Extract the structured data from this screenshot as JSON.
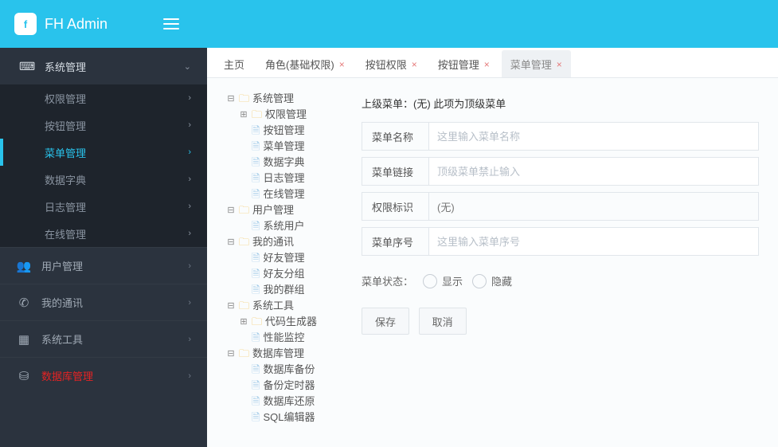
{
  "brand": {
    "logo": "f",
    "title": "FH Admin"
  },
  "sidebar": {
    "active_group": "系统管理",
    "groups": [
      {
        "icon": "⌨",
        "label": "系统管理",
        "sub": [
          {
            "label": "权限管理"
          },
          {
            "label": "按钮管理"
          },
          {
            "label": "菜单管理",
            "active": true
          },
          {
            "label": "数据字典"
          },
          {
            "label": "日志管理"
          },
          {
            "label": "在线管理"
          }
        ]
      },
      {
        "icon": "👥",
        "label": "用户管理"
      },
      {
        "icon": "✆",
        "label": "我的通讯"
      },
      {
        "icon": "▦",
        "label": "系统工具"
      },
      {
        "icon": "⛁",
        "label": "数据库管理",
        "red": true
      }
    ]
  },
  "tabs": [
    {
      "label": "主页"
    },
    {
      "label": "角色(基础权限)",
      "close": true
    },
    {
      "label": "按钮权限",
      "close": true
    },
    {
      "label": "按钮管理",
      "close": true
    },
    {
      "label": "菜单管理",
      "close": true,
      "active": true
    }
  ],
  "tree": [
    {
      "label": "系统管理",
      "type": "folder",
      "open": true,
      "children": [
        {
          "label": "权限管理",
          "type": "folder",
          "closed": true
        },
        {
          "label": "按钮管理",
          "type": "file"
        },
        {
          "label": "菜单管理",
          "type": "file"
        },
        {
          "label": "数据字典",
          "type": "file"
        },
        {
          "label": "日志管理",
          "type": "file"
        },
        {
          "label": "在线管理",
          "type": "file"
        }
      ]
    },
    {
      "label": "用户管理",
      "type": "folder",
      "open": true,
      "children": [
        {
          "label": "系统用户",
          "type": "file"
        }
      ]
    },
    {
      "label": "我的通讯",
      "type": "folder",
      "open": true,
      "children": [
        {
          "label": "好友管理",
          "type": "file"
        },
        {
          "label": "好友分组",
          "type": "file"
        },
        {
          "label": "我的群组",
          "type": "file"
        }
      ]
    },
    {
      "label": "系统工具",
      "type": "folder",
      "open": true,
      "children": [
        {
          "label": "代码生成器",
          "type": "folder",
          "closed": true
        },
        {
          "label": "性能监控",
          "type": "file"
        }
      ]
    },
    {
      "label": "数据库管理",
      "type": "folder",
      "open": true,
      "children": [
        {
          "label": "数据库备份",
          "type": "file"
        },
        {
          "label": "备份定时器",
          "type": "file"
        },
        {
          "label": "数据库还原",
          "type": "file"
        },
        {
          "label": "SQL编辑器",
          "type": "file"
        }
      ]
    }
  ],
  "form": {
    "parent_label": "上级菜单：",
    "parent_value": "(无) 此项为顶级菜单",
    "name_label": "菜单名称",
    "name_placeholder": "这里输入菜单名称",
    "url_label": "菜单链接",
    "url_placeholder": "顶级菜单禁止输入",
    "perm_label": "权限标识",
    "perm_value": "(无)",
    "order_label": "菜单序号",
    "order_placeholder": "这里输入菜单序号",
    "status_label": "菜单状态：",
    "status_show": "显示",
    "status_hide": "隐藏",
    "btn_save": "保存",
    "btn_cancel": "取消"
  }
}
